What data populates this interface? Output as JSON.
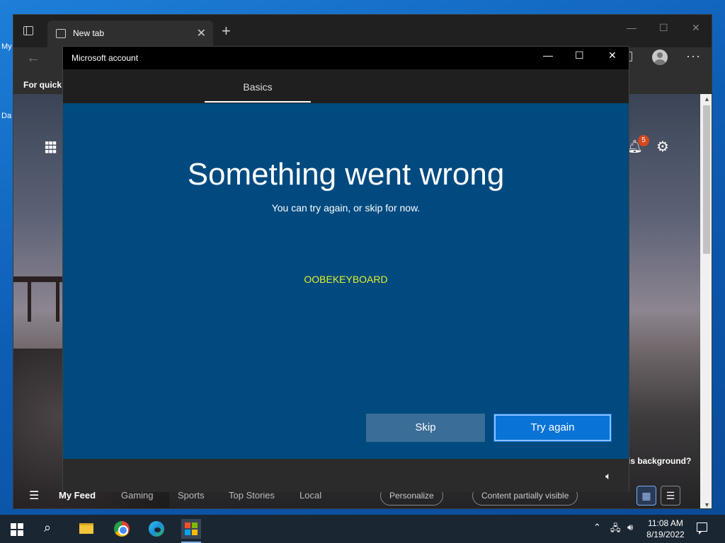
{
  "desktop": {
    "icon_label_1": "My",
    "icon_label_2": "Da"
  },
  "browser": {
    "tab": {
      "title": "New tab",
      "close_glyph": "✕"
    },
    "new_tab_glyph": "+",
    "window_controls": {
      "minimize": "—",
      "maximize": "☐",
      "close": "✕"
    },
    "back_glyph": "←",
    "more_glyph": "···",
    "favorites_bar_text": "For quick a",
    "new_tab_page": {
      "notification_count": "5",
      "background_question": "is background?",
      "feed_items": [
        "My Feed",
        "Gaming",
        "Sports",
        "Top Stories",
        "Local"
      ],
      "personalize": "Personalize",
      "content_visibility": "Content partially visible"
    }
  },
  "dialog": {
    "title": "Microsoft account",
    "window_controls": {
      "minimize": "—",
      "maximize": "☐",
      "close": "✕"
    },
    "tab_label": "Basics",
    "heading": "Something went wrong",
    "subheading": "You can try again, or skip for now.",
    "code": "OOBEKEYBOARD",
    "skip_label": "Skip",
    "try_again_label": "Try again"
  },
  "taskbar": {
    "time": "11:08 AM",
    "date": "8/19/2022"
  },
  "icons": {
    "start": "windows-logo-icon",
    "search": "search-icon",
    "file_explorer": "folder-icon",
    "chrome": "chrome-icon",
    "edge": "edge-icon",
    "store": "store-icon",
    "volume": "volume-icon",
    "network": "network-icon"
  },
  "colors": {
    "dialog_body": "#004a7f",
    "primary_button": "#0a74d6",
    "secondary_button": "#3a6d97",
    "code_text": "#e5f02a"
  }
}
